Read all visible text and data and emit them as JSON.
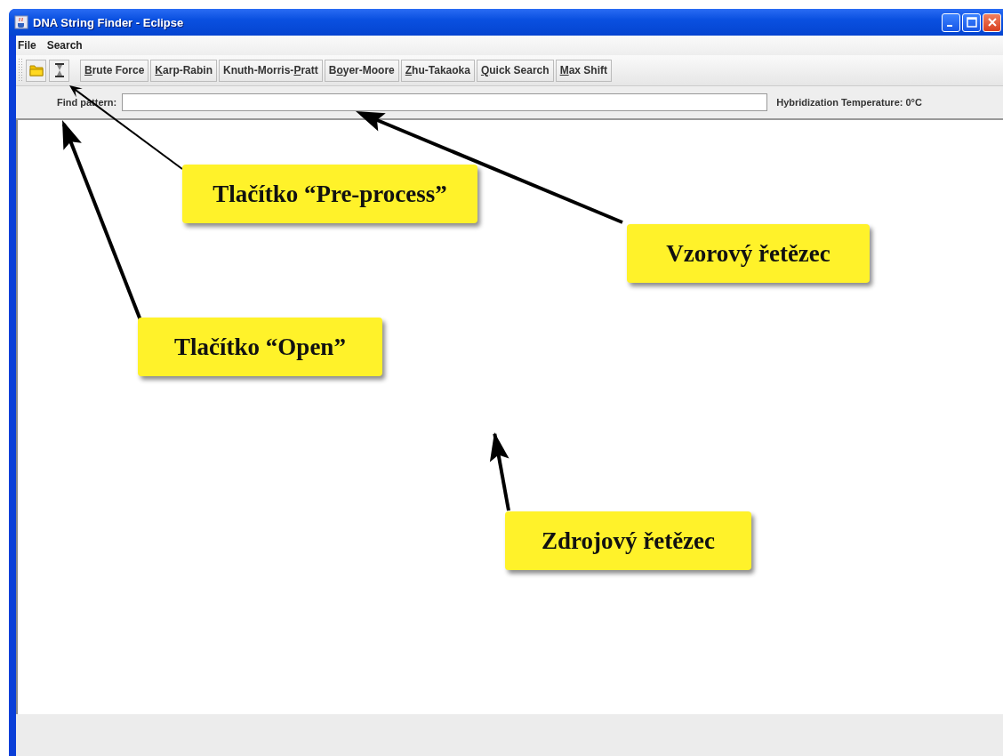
{
  "window": {
    "title": "DNA String Finder - Eclipse"
  },
  "menu": [
    "File",
    "Search"
  ],
  "toolbar": {
    "icon_buttons": [
      {
        "kind": "open"
      },
      {
        "kind": "preprocess"
      }
    ],
    "algorithm_buttons": [
      {
        "key": "B",
        "post": "rute Force"
      },
      {
        "key": "K",
        "post": "arp-Rabin"
      },
      {
        "pre": "Knuth-Morris-",
        "key": "P",
        "post": "ratt"
      },
      {
        "pre": "B",
        "key": "o",
        "post": "yer-Moore"
      },
      {
        "key": "Z",
        "post": "hu-Takaoka"
      },
      {
        "key": "Q",
        "post": "uick Search"
      },
      {
        "key": "M",
        "post": "ax Shift"
      }
    ]
  },
  "find_row": {
    "label": "Find pattern:",
    "hybridization": "Hybridization Temperature: 0°C"
  },
  "callouts": [
    {
      "kind": "preprocess",
      "text": "Tlačítko “Pre-process”"
    },
    {
      "kind": "pattern",
      "text": "Vzorový řetězec"
    },
    {
      "kind": "open",
      "text": "Tlačítko “Open”"
    },
    {
      "kind": "source",
      "text": "Zdrojový řetězec"
    }
  ]
}
